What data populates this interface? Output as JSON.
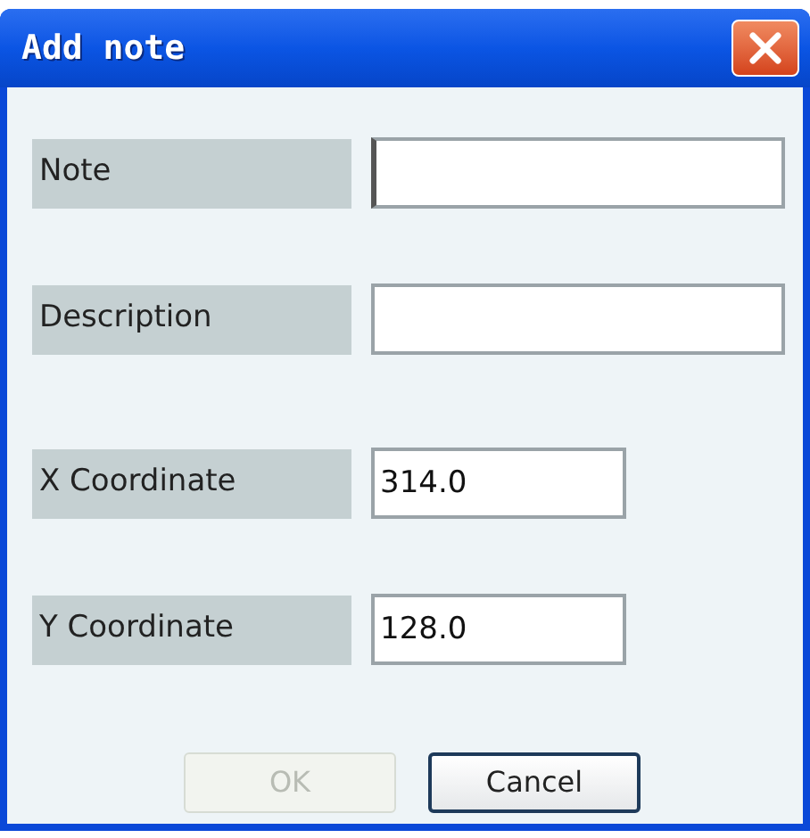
{
  "window": {
    "title": "Add note"
  },
  "fields": [
    {
      "label": "Note",
      "focused": true,
      "kind": "text"
    },
    {
      "label": "Description",
      "focused": false,
      "kind": "text"
    },
    {
      "label": "X Coordinate",
      "value": "314.0",
      "focused": false,
      "kind": "number"
    },
    {
      "label": "Y Coordinate",
      "value": "128.0",
      "focused": false,
      "kind": "number"
    }
  ],
  "buttons": [
    {
      "label": "OK",
      "disabled": true
    },
    {
      "label": "Cancel",
      "disabled": false
    }
  ]
}
